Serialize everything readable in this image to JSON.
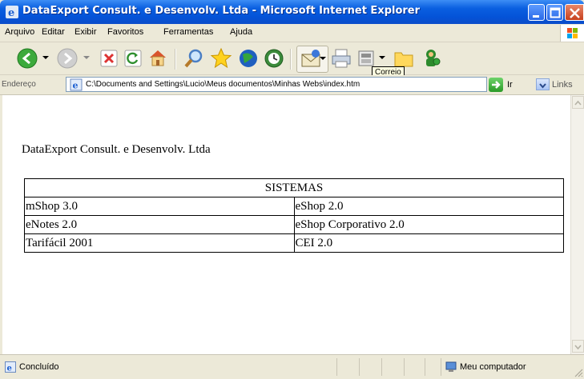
{
  "window": {
    "title": "DataExport Consult. e Desenvolv. Ltda - Microsoft Internet Explorer"
  },
  "menu": {
    "items": [
      "Arquivo",
      "Editar",
      "Exibir",
      "Favoritos",
      "Ferramentas",
      "Ajuda"
    ]
  },
  "toolbar": {
    "tooltip": "Correio",
    "icons": [
      "back-arrow-icon",
      "forward-arrow-icon",
      "stop-icon",
      "refresh-icon",
      "home-icon",
      "search-icon",
      "favorites-star-icon",
      "media-icon",
      "history-icon",
      "mail-icon",
      "print-icon",
      "edit-icon",
      "folder-icon",
      "messenger-icon"
    ]
  },
  "address": {
    "label": "Endereço",
    "value": "C:\\Documents and Settings\\Lucio\\Meus documentos\\Minhas Webs\\index.htm",
    "go_label": "Ir",
    "links_label": "Links"
  },
  "page": {
    "heading": "DataExport Consult. e Desenvolv. Ltda",
    "table": {
      "header": "SISTEMAS",
      "rows": [
        [
          "mShop 3.0",
          "eShop 2.0"
        ],
        [
          "eNotes 2.0",
          "eShop Corporativo 2.0"
        ],
        [
          "Tarifácil 2001",
          "CEI 2.0"
        ]
      ]
    }
  },
  "status": {
    "text": "Concluído",
    "zone": "Meu computador"
  },
  "colors": {
    "titlebar": "#0a5fe0",
    "chrome": "#ece9d8"
  }
}
